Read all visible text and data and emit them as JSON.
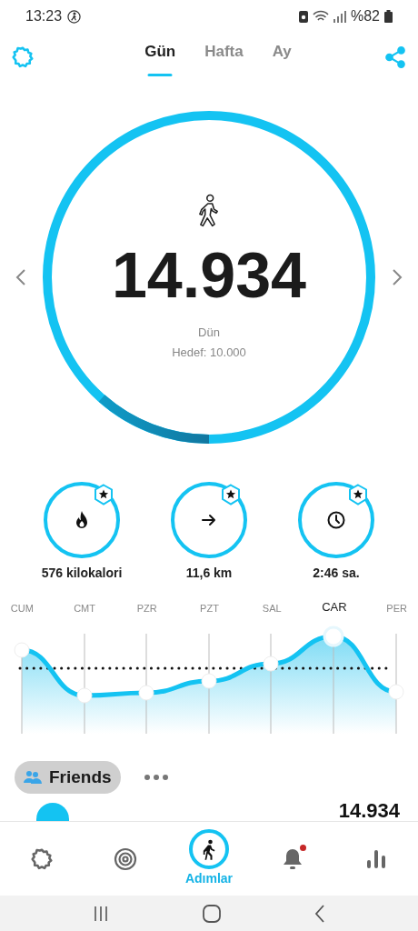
{
  "status_bar": {
    "time": "13:23",
    "battery": "%82"
  },
  "tabs": [
    {
      "label": "Gün",
      "selected": true
    },
    {
      "label": "Hafta",
      "selected": false
    },
    {
      "label": "Ay",
      "selected": false
    }
  ],
  "main": {
    "steps": "14.934",
    "day": "Dün",
    "goal": "Hedef: 10.000"
  },
  "stats": [
    {
      "kind": "calories",
      "value": "576 kilokalori"
    },
    {
      "kind": "distance",
      "value": "11,6 km"
    },
    {
      "kind": "time",
      "value": "2:46 sa."
    }
  ],
  "week": [
    {
      "label": "CUM",
      "selected": false
    },
    {
      "label": "CMT",
      "selected": false
    },
    {
      "label": "PZR",
      "selected": false
    },
    {
      "label": "PZT",
      "selected": false
    },
    {
      "label": "SAL",
      "selected": false
    },
    {
      "label": "CAR",
      "selected": true
    },
    {
      "label": "PER",
      "selected": false
    }
  ],
  "friends": {
    "label": "Friends",
    "steps": "14.934"
  },
  "nav": [
    {
      "kind": "settings",
      "selected": false,
      "badge": false
    },
    {
      "kind": "goal",
      "selected": false,
      "badge": false
    },
    {
      "kind": "steps",
      "label": "Adımlar",
      "selected": true,
      "badge": false
    },
    {
      "kind": "alerts",
      "selected": false,
      "badge": true
    },
    {
      "kind": "stats",
      "selected": false,
      "badge": false
    }
  ]
}
